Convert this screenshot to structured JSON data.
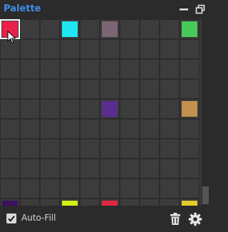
{
  "panel": {
    "title": "Palette"
  },
  "window_controls": {
    "minimize_icon": "minimize-icon",
    "popout_icon": "popout-icon"
  },
  "palette": {
    "columns": 10,
    "rows": 10,
    "selected_index": 0,
    "swatches": [
      {
        "index": 0,
        "color": "#e8204a"
      },
      {
        "index": 3,
        "color": "#1fe6f2"
      },
      {
        "index": 5,
        "color": "#7b6773"
      },
      {
        "index": 9,
        "color": "#47c95a"
      },
      {
        "index": 45,
        "color": "#5a2e8e"
      },
      {
        "index": 49,
        "color": "#c29150"
      },
      {
        "index": 90,
        "color": "#3a1061"
      },
      {
        "index": 93,
        "color": "#d4f016"
      },
      {
        "index": 95,
        "color": "#e02840"
      },
      {
        "index": 99,
        "color": "#e2cc28"
      }
    ]
  },
  "footer": {
    "auto_fill_label": "Auto-Fill",
    "auto_fill_checked": true,
    "delete_icon": "trash-icon",
    "settings_icon": "gear-icon"
  }
}
